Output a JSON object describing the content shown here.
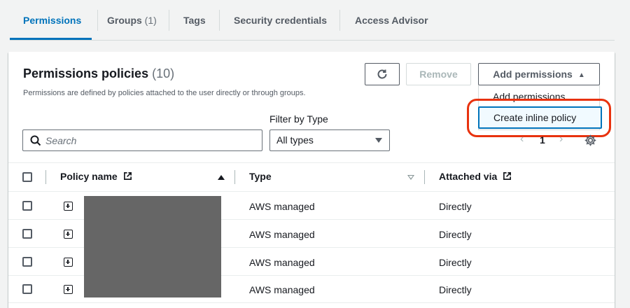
{
  "tabs": [
    {
      "label": "Permissions",
      "count": ""
    },
    {
      "label": "Groups",
      "count": "(1)"
    },
    {
      "label": "Tags",
      "count": ""
    },
    {
      "label": "Security credentials",
      "count": ""
    },
    {
      "label": "Access Advisor",
      "count": ""
    }
  ],
  "panel": {
    "title": "Permissions policies",
    "count": "(10)",
    "description": "Permissions are defined by policies attached to the user directly or through groups."
  },
  "toolbar": {
    "refresh_icon": "refresh-icon",
    "remove_label": "Remove",
    "add_label": "Add permissions"
  },
  "add_menu": {
    "items": [
      "Add permissions",
      "Create inline policy"
    ],
    "highlighted": "Create inline policy",
    "highlight_color": "#e8320e"
  },
  "filter": {
    "search_placeholder": "Search",
    "type_label": "Filter by Type",
    "type_value": "All types"
  },
  "pagination": {
    "current_page": "1"
  },
  "table": {
    "columns": [
      "Policy name",
      "Type",
      "Attached via"
    ],
    "rows": [
      {
        "type": "AWS managed",
        "attached_via": "Directly"
      },
      {
        "type": "AWS managed",
        "attached_via": "Directly"
      },
      {
        "type": "AWS managed",
        "attached_via": "Directly"
      },
      {
        "type": "AWS managed",
        "attached_via": "Directly"
      }
    ]
  },
  "colors": {
    "accent": "#0073bb",
    "text": "#16191f",
    "muted": "#545b64"
  }
}
